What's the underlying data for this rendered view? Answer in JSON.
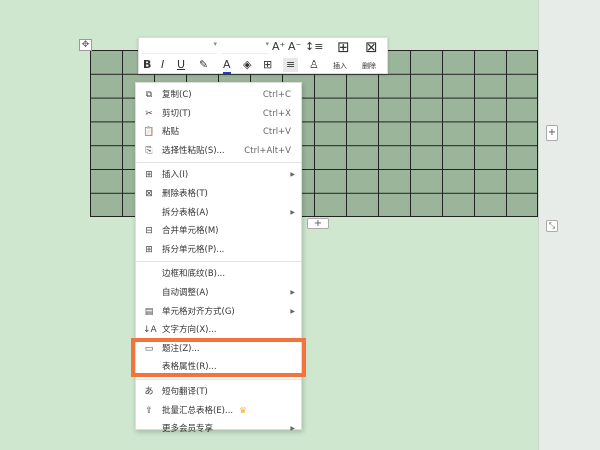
{
  "toolbar": {
    "font_name": "",
    "font_size": "",
    "grow_font": "A⁺",
    "shrink_font": "A⁻",
    "line_spacing": "↕≡",
    "bold": "B",
    "italic": "I",
    "underline": "U",
    "highlight": "✎",
    "font_color": "A",
    "shading": "◈",
    "borders": "⊞",
    "align": "≡",
    "clear": "♙",
    "insert_label": "插入",
    "delete_label": "删除"
  },
  "menu": {
    "group1": [
      {
        "icon": "copy-icon",
        "glyph": "⧉",
        "label": "复制(C)",
        "shortcut": "Ctrl+C"
      },
      {
        "icon": "cut-icon",
        "glyph": "✂",
        "label": "剪切(T)",
        "shortcut": "Ctrl+X"
      },
      {
        "icon": "paste-icon",
        "glyph": "📋",
        "label": "粘贴",
        "shortcut": "Ctrl+V"
      },
      {
        "icon": "paste-special-icon",
        "glyph": "⎘",
        "label": "选择性粘贴(S)...",
        "shortcut": "Ctrl+Alt+V"
      }
    ],
    "group2": [
      {
        "icon": "insert-table-icon",
        "glyph": "⊞",
        "label": "插入(I)",
        "sub": true
      },
      {
        "icon": "delete-table-icon",
        "glyph": "⊠",
        "label": "删除表格(T)"
      },
      {
        "icon": "",
        "glyph": "",
        "label": "拆分表格(A)",
        "sub": true
      },
      {
        "icon": "merge-cells-icon",
        "glyph": "⊟",
        "label": "合并单元格(M)"
      },
      {
        "icon": "split-cells-icon",
        "glyph": "⊞",
        "label": "拆分单元格(P)..."
      }
    ],
    "group3": [
      {
        "icon": "",
        "glyph": "",
        "label": "边框和底纹(B)..."
      },
      {
        "icon": "",
        "glyph": "",
        "label": "自动调整(A)",
        "sub": true
      },
      {
        "icon": "cell-align-icon",
        "glyph": "▤",
        "label": "单元格对齐方式(G)",
        "sub": true
      },
      {
        "icon": "text-direction-icon",
        "glyph": "↓A",
        "label": "文字方向(X)..."
      },
      {
        "icon": "caption-icon",
        "glyph": "▭",
        "label": "题注(Z)..."
      },
      {
        "icon": "",
        "glyph": "",
        "label": "表格属性(R)..."
      }
    ],
    "group4": [
      {
        "icon": "translate-icon",
        "glyph": "あ",
        "label": "短句翻译(T)"
      },
      {
        "icon": "batch-summary-icon",
        "glyph": "⇪",
        "label": "批量汇总表格(E)...",
        "crown": "♛"
      },
      {
        "icon": "",
        "glyph": "",
        "label": "更多会员专享",
        "sub": true
      }
    ]
  },
  "colors": {
    "highlight": "#f4733d",
    "table_fill": "#9bb59b",
    "background": "#cfe6cf"
  }
}
